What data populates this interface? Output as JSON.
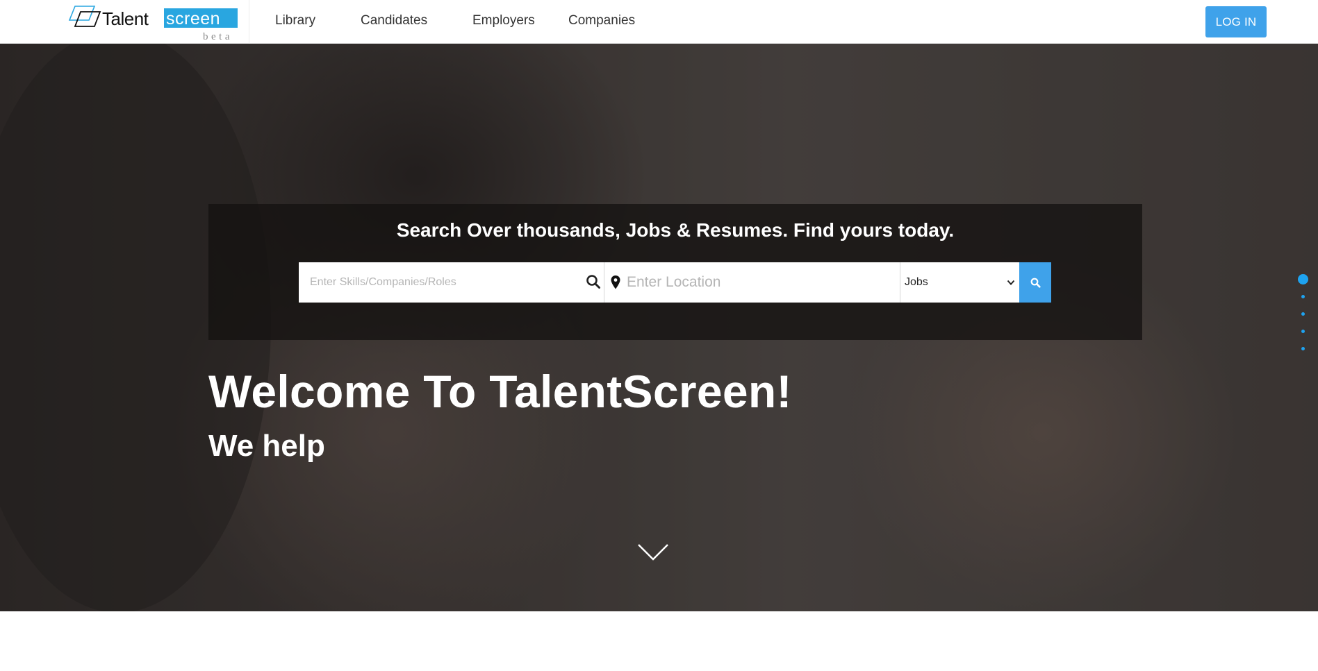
{
  "header": {
    "logo": {
      "word_talent": "Talent",
      "word_screen": "screen",
      "tagline": "beta",
      "brand_color": "#29a6e0"
    },
    "nav": [
      {
        "label": "Library"
      },
      {
        "label": "Candidates"
      },
      {
        "label": "Employers"
      },
      {
        "label": "Companies"
      }
    ],
    "login_label": "LOG IN"
  },
  "hero": {
    "search": {
      "title": "Search Over thousands, Jobs & Resumes. Find yours today.",
      "skills_placeholder": "Enter Skills/Companies/Roles",
      "location_placeholder": "Enter Location",
      "type_selected": "Jobs",
      "skills_icon": "search-icon",
      "location_icon": "map-pin-icon",
      "button_icon": "search-icon"
    },
    "welcome": "Welcome To TalentScreen!",
    "subhead": "We help",
    "slides": {
      "count": 5,
      "active_index": 0
    },
    "accent_color": "#3fa2ea"
  }
}
